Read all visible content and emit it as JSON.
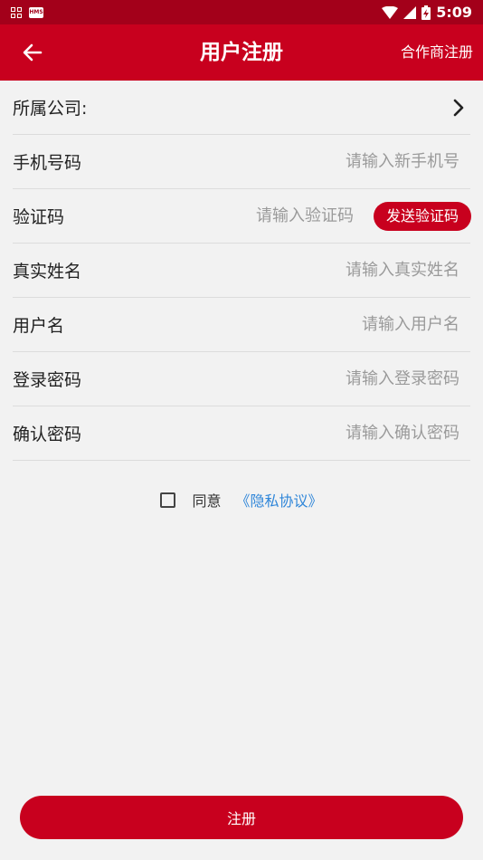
{
  "status_bar": {
    "time": "5:09",
    "hms_badge": "HMS"
  },
  "header": {
    "title": "用户注册",
    "partner_register": "合作商注册"
  },
  "form": {
    "company": {
      "label": "所属公司:"
    },
    "phone": {
      "label": "手机号码",
      "placeholder": "请输入新手机号"
    },
    "code": {
      "label": "验证码",
      "placeholder": "请输入验证码",
      "send_label": "发送验证码"
    },
    "realname": {
      "label": "真实姓名",
      "placeholder": "请输入真实姓名"
    },
    "username": {
      "label": "用户名",
      "placeholder": "请输入用户名"
    },
    "password": {
      "label": "登录密码",
      "placeholder": "请输入登录密码"
    },
    "confirm": {
      "label": "确认密码",
      "placeholder": "请输入确认密码"
    }
  },
  "agreement": {
    "agree_text": "同意",
    "privacy_link": "《隐私协议》"
  },
  "register_button": "注册",
  "colors": {
    "primary": "#c8001e",
    "status_bar": "#a3001a",
    "link": "#2f86d9",
    "background": "#f2f2f2"
  }
}
